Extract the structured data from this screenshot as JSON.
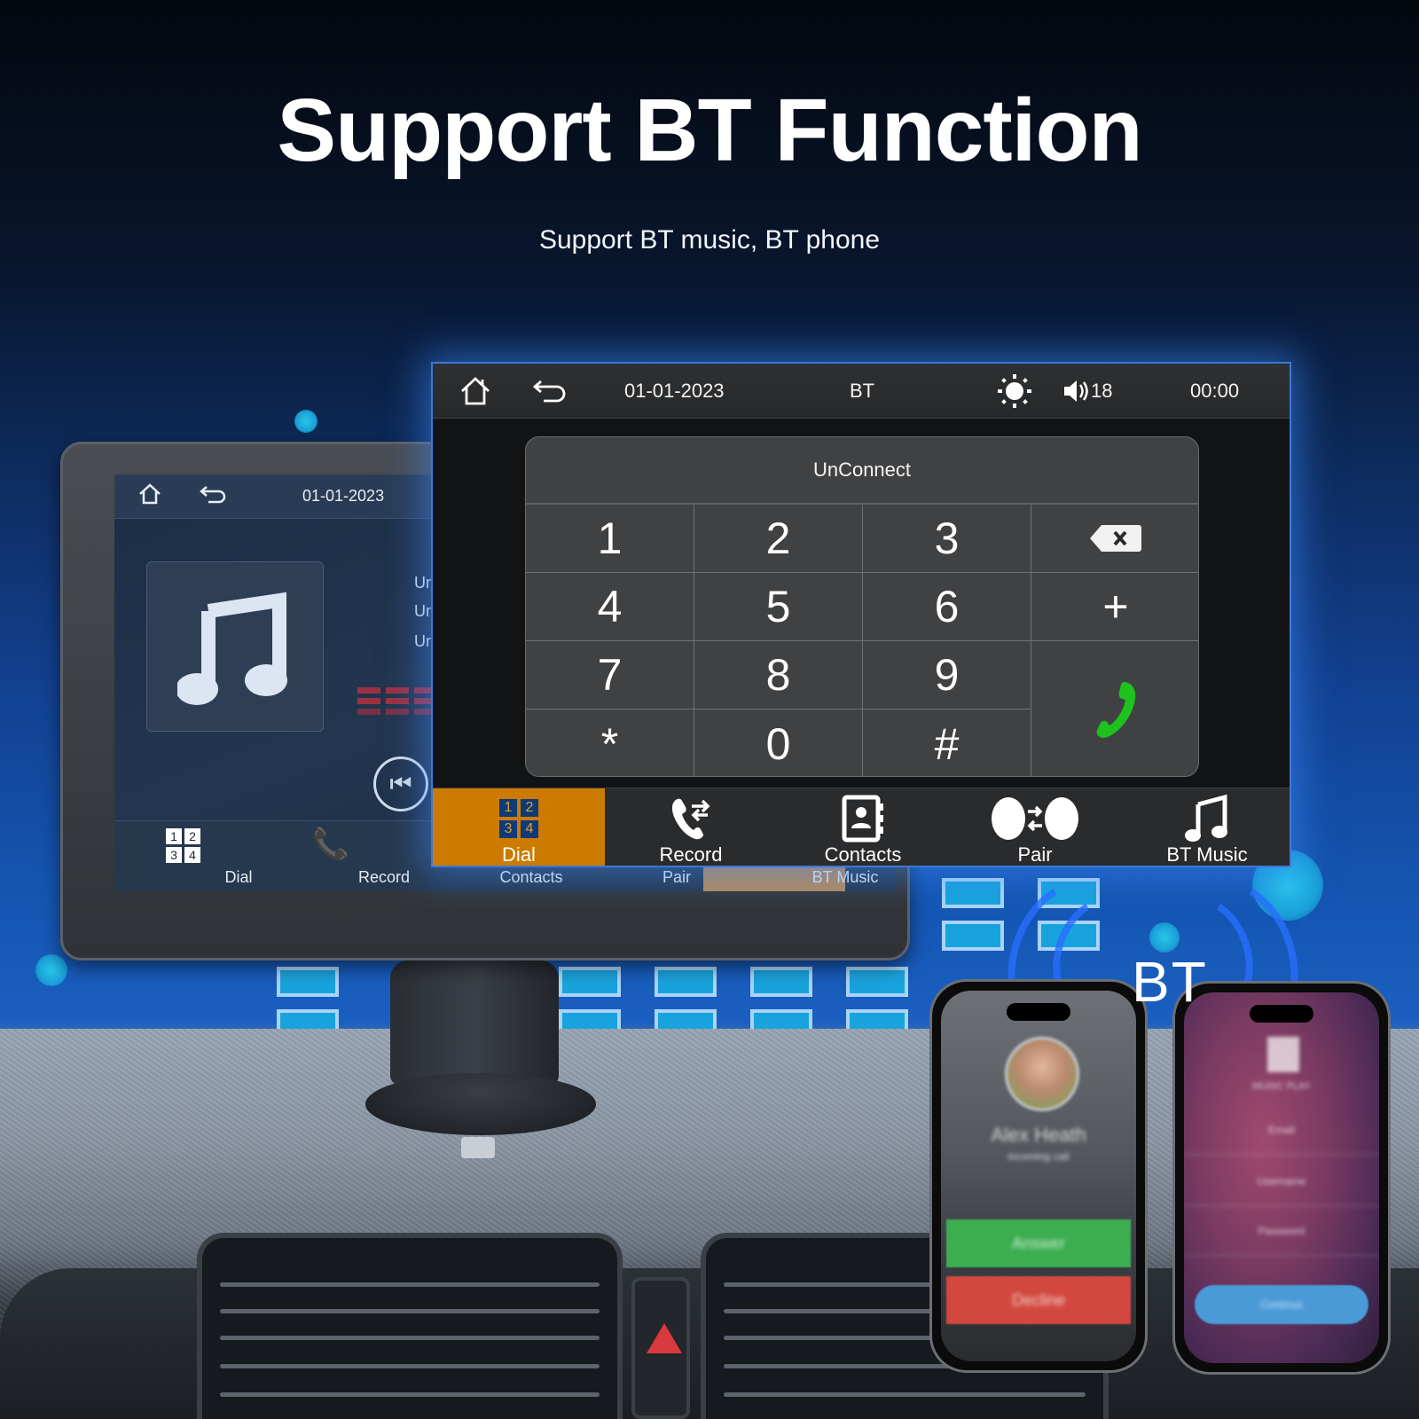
{
  "headline": {
    "title": "Support BT Function",
    "subtitle": "Support BT music, BT phone"
  },
  "main_screen": {
    "topbar": {
      "home_icon": "home-icon",
      "back_icon": "back-arrow-icon",
      "date": "01-01-2023",
      "mode": "BT",
      "brightness_icon": "sun-icon",
      "volume_icon": "speaker-icon",
      "volume": "18",
      "time": "00:00"
    },
    "dialpad": {
      "status": "UnConnect",
      "keys": [
        [
          "1",
          "2",
          "3",
          "backspace"
        ],
        [
          "4",
          "5",
          "6",
          "+"
        ],
        [
          "7",
          "8",
          "9",
          "call"
        ],
        [
          "*",
          "0",
          "#"
        ]
      ],
      "key_labels": {
        "k1": "1",
        "k2": "2",
        "k3": "3",
        "k4": "4",
        "k5": "5",
        "k6": "6",
        "k7": "7",
        "k8": "8",
        "k9": "9",
        "kstar": "*",
        "k0": "0",
        "khash": "#",
        "kplus": "+"
      },
      "call_color": "#1ec21e"
    },
    "nav": {
      "active": "Dial",
      "active_color": "#cc7a00",
      "tabs": [
        {
          "label": "Dial",
          "icon": "dialpad-grid-icon"
        },
        {
          "label": "Record",
          "icon": "call-log-icon"
        },
        {
          "label": "Contacts",
          "icon": "contacts-book-icon"
        },
        {
          "label": "Pair",
          "icon": "pair-icon"
        },
        {
          "label": "BT Music",
          "icon": "music-note-icon"
        }
      ],
      "dial_icon_digits": [
        "1",
        "2",
        "3",
        "4"
      ]
    }
  },
  "back_screen": {
    "date": "01-01-2023",
    "track_lines": [
      "Un",
      "Un",
      "Un"
    ],
    "tabs": [
      {
        "label": "Dial"
      },
      {
        "label": "Record"
      },
      {
        "label": "Contacts"
      },
      {
        "label": "Pair"
      },
      {
        "label": "BT Music"
      }
    ],
    "dial_icon_digits": [
      "1",
      "2",
      "3",
      "4"
    ]
  },
  "phones": {
    "bt_label": "BT",
    "call_phone": {
      "caller": "Alex Heath",
      "status": "incoming call",
      "answer_label": "Answer",
      "decline_label": "Decline",
      "answer_color": "#3cae50",
      "decline_color": "#d2483e"
    },
    "music_phone": {
      "lines": [
        "MUSIC PLAY",
        "Email",
        "Username",
        "Password"
      ],
      "button_label": "Continue",
      "button_color": "#4a9ad8"
    }
  }
}
